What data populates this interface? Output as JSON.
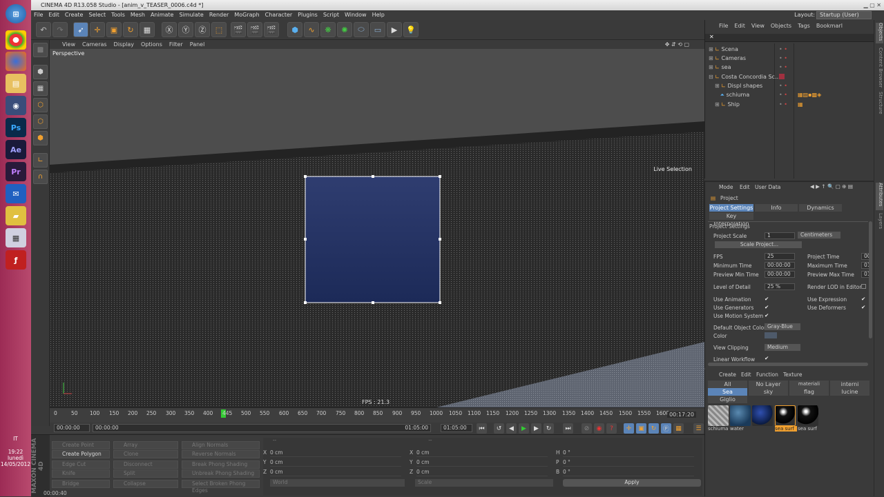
{
  "app": {
    "title": "CINEMA 4D R13.058 Studio - [anim_v_TEASER_0006.c4d *]"
  },
  "menu": [
    "File",
    "Edit",
    "Create",
    "Select",
    "Tools",
    "Mesh",
    "Animate",
    "Simulate",
    "Render",
    "MoGraph",
    "Character",
    "Plugins",
    "Script",
    "Window",
    "Help"
  ],
  "layout": {
    "label": "Layout:",
    "value": "Startup (User)"
  },
  "viewport": {
    "menu": [
      "View",
      "Cameras",
      "Display",
      "Options",
      "Filter",
      "Panel"
    ],
    "label": "Perspective",
    "fps": "FPS : 21.3",
    "live_selection": "Live Selection"
  },
  "timeline": {
    "ticks": [
      "0",
      "50",
      "100",
      "150",
      "200",
      "250",
      "300",
      "350",
      "400",
      "445",
      "500",
      "550",
      "600",
      "650",
      "700",
      "750",
      "800",
      "850",
      "900",
      "950",
      "1000",
      "1050",
      "1100",
      "1150",
      "1200",
      "1250",
      "1300",
      "1350",
      "1400",
      "1450",
      "1500",
      "1550",
      "1600"
    ],
    "current": "445",
    "time": "00:17:20"
  },
  "transport": {
    "start": "00:00:00",
    "range_start": "00:00:00",
    "range_end": "01:05:00",
    "end": "01:05:00"
  },
  "structure": {
    "buttons": [
      "Create Point",
      "Create Polygon",
      "Edge Cut",
      "Knife",
      "Bridge",
      "Array",
      "Clone",
      "Disconnect",
      "Split",
      "Collapse",
      "Align Normals",
      "Reverse Normals",
      "Break Phong Shading",
      "Unbreak Phong Shading",
      "Select Broken Phong Edges"
    ]
  },
  "coords": {
    "rows": [
      {
        "a": "X",
        "v1": "0 cm",
        "b": "X",
        "v2": "0 cm",
        "c": "H",
        "v3": "0 °"
      },
      {
        "a": "Y",
        "v1": "0 cm",
        "b": "Y",
        "v2": "0 cm",
        "c": "P",
        "v3": "0 °"
      },
      {
        "a": "Z",
        "v1": "0 cm",
        "b": "Z",
        "v2": "0 cm",
        "c": "B",
        "v3": "0 °"
      }
    ],
    "world": "World",
    "scale": "Scale",
    "apply": "Apply"
  },
  "status": "00:00:40",
  "objects": {
    "menu": [
      "File",
      "Edit",
      "View",
      "Objects",
      "Tags",
      "Bookmarl"
    ],
    "items": [
      "Scena",
      "Cameras",
      "sea",
      "Costa Concordia Sc...",
      "Displ shapes",
      "schiuma",
      "Ship"
    ]
  },
  "attributes": {
    "menu": [
      "Mode",
      "Edit",
      "User Data"
    ],
    "title": "Project",
    "tabs": [
      "Project Settings",
      "Info",
      "Dynamics",
      "Key Interpolation"
    ],
    "section": "Project Settings",
    "project_scale": "Project Scale",
    "project_scale_val": "1",
    "units": "Centimeters",
    "scale_project": "Scale Project...",
    "fps": "FPS",
    "fps_val": "25",
    "project_time": "Project Time",
    "project_time_val": "00",
    "min_time": "Minimum Time",
    "min_time_val": "00:00:00",
    "max_time": "Maximum Time",
    "max_time_val": "01",
    "prev_min": "Preview Min Time",
    "prev_min_val": "00:00:00",
    "prev_max": "Preview Max Time",
    "prev_max_val": "01",
    "lod": "Level of Detail",
    "lod_val": "25 %",
    "render_lod": "Render LOD in Editor",
    "use_anim": "Use Animation",
    "use_expr": "Use Expression",
    "use_gen": "Use Generators",
    "use_def": "Use Deformers",
    "use_motion": "Use Motion System",
    "def_color": "Default Object Color",
    "def_color_val": "Gray-Blue",
    "color": "Color",
    "view_clip": "View Clipping",
    "view_clip_val": "Medium",
    "linear": "Linear Workflow"
  },
  "materials": {
    "menu": [
      "Create",
      "Edit",
      "Function",
      "Texture"
    ],
    "tabs": [
      "All",
      "No Layer",
      "materiali carena",
      "interni",
      "Sea",
      "sky",
      "flag",
      "lucine",
      "Giglio"
    ],
    "items": [
      "schiuma",
      "water",
      "",
      "sea surf",
      "sea surf"
    ]
  },
  "taskbar": {
    "lang": "IT",
    "time": "19:22",
    "day": "lunedì",
    "date": "14/05/2012"
  },
  "sidetabs": [
    "Objects",
    "Content Browser",
    "Structure",
    "Attributes",
    "Layers"
  ]
}
